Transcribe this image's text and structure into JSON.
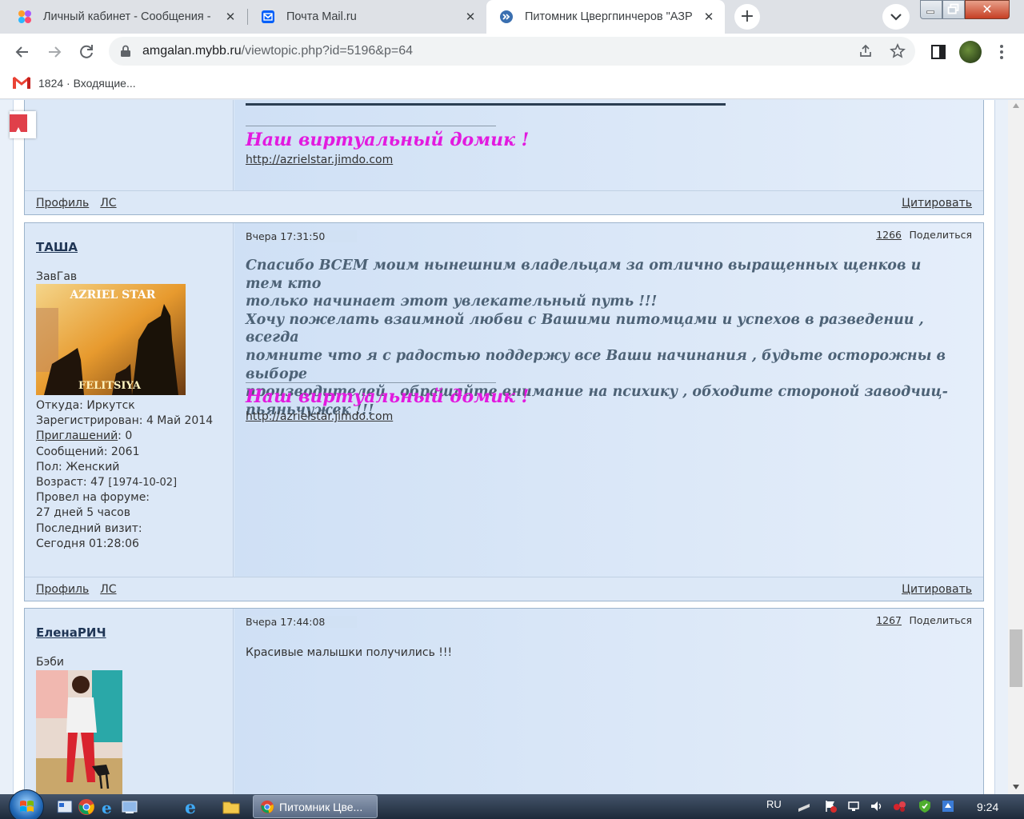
{
  "browser": {
    "tabs": [
      {
        "title": "Личный кабинет - Сообщения - ",
        "icon": "mail-app-icon"
      },
      {
        "title": "Почта Mail.ru",
        "icon": "mail-ru-icon"
      },
      {
        "title": "Питомник Цвергпинчеров \"АЗР",
        "icon": "mybb-icon"
      }
    ],
    "new_tab_label": "+",
    "close_label": "✕",
    "url_host": "amgalan.mybb.ru",
    "url_path": "/viewtopic.php?id=5196&p=64",
    "bookmark_label": "1824 · Входящие..."
  },
  "posts": [
    {
      "footer_profile": "Профиль",
      "footer_pm": "ЛС",
      "footer_quote": "Цитировать",
      "signature_title": "Наш виртуальный домик !",
      "signature_link": "http://azrielstar.jimdo.com"
    },
    {
      "date": "Вчера 17:31:50",
      "number": "1266",
      "share": "Поделиться",
      "author": "ТАША",
      "author_title": "ЗавГав",
      "avatar_text_top": "AZRIEL STAR",
      "avatar_text_bottom": "FELITSIYA",
      "info_from": "Откуда: Иркутск",
      "info_registered": "Зарегистрирован: 4 Май 2014",
      "info_invites_label": "Приглашений",
      "info_invites_value": ": 0",
      "info_posts": "Сообщений: 2061",
      "info_gender": "Пол: Женский",
      "info_age": "Возраст: 47",
      "info_birth": "[1974-10-02]",
      "info_time_label": "Провел на форуме:",
      "info_time_value": "27 дней 5 часов",
      "info_last_label": "Последний визит:",
      "info_last_value": "Сегодня 01:28:06",
      "body_line1": "Спасибо ВСЕМ моим нынешним владельцам за отлично выращенных щенков и тем кто",
      "body_line2": "только начинает этот увлекательный путь !!!",
      "body_line3": "Хочу пожелать взаимной любви с Вашими питомцами и успехов в разведении , всегда",
      "body_line4": "помните что я с радостью поддержу все Ваши начинания , будьте осторожны в выборе",
      "body_line5": "производителей , обращайте внимание на психику , обходите стороной заводчиц-",
      "body_line6": "пьяньчужек !!!",
      "signature_title": "Наш виртуальный домик !",
      "signature_link": "http://azrielstar.jimdo.com",
      "footer_profile": "Профиль",
      "footer_pm": "ЛС",
      "footer_quote": "Цитировать"
    },
    {
      "date": "Вчера 17:44:08",
      "number": "1267",
      "share": "Поделиться",
      "author": "ЕленаРИЧ",
      "author_title": "Бэби",
      "body": "Красивые малышки получились !!!"
    }
  ],
  "taskbar": {
    "task_label": "Питомник Цве...",
    "language": "RU",
    "clock": "9:24"
  },
  "colors": {
    "signature_magenta": "#e21adf",
    "post_text": "#4d6276",
    "username": "#1f3555"
  }
}
